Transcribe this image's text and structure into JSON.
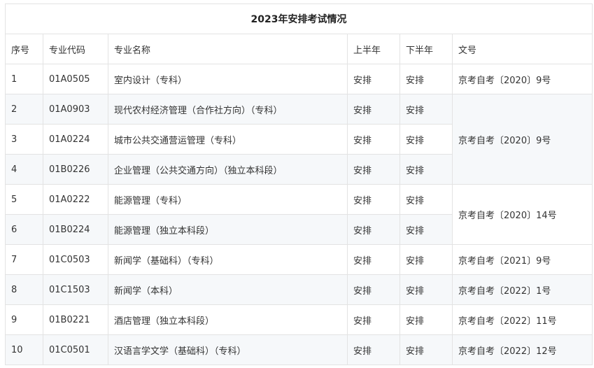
{
  "title": "2023年安排考试情况",
  "headers": {
    "seq": "序号",
    "code": "专业代码",
    "name": "专业名称",
    "h1": "上半年",
    "h2": "下半年",
    "doc": "文号"
  },
  "rows": [
    {
      "seq": "1",
      "code": "01A0505",
      "name": "室内设计（专科）",
      "h1": "安排",
      "h2": "安排"
    },
    {
      "seq": "2",
      "code": "01A0903",
      "name": "现代农村经济管理（合作社方向）（专科）",
      "h1": "安排",
      "h2": "安排"
    },
    {
      "seq": "3",
      "code": "01A0224",
      "name": "城市公共交通营运管理（专科）",
      "h1": "安排",
      "h2": "安排"
    },
    {
      "seq": "4",
      "code": "01B0226",
      "name": "企业管理（公共交通方向）（独立本科段）",
      "h1": "安排",
      "h2": "安排"
    },
    {
      "seq": "5",
      "code": "01A0222",
      "name": "能源管理（专科）",
      "h1": "安排",
      "h2": "安排"
    },
    {
      "seq": "6",
      "code": "01B0224",
      "name": "能源管理（独立本科段）",
      "h1": "安排",
      "h2": "安排"
    },
    {
      "seq": "7",
      "code": "01C0503",
      "name": "新闻学（基础科）（专科）",
      "h1": "安排",
      "h2": "安排"
    },
    {
      "seq": "8",
      "code": "01C1503",
      "name": "新闻学（本科）",
      "h1": "安排",
      "h2": "安排"
    },
    {
      "seq": "9",
      "code": "01B0221",
      "name": "酒店管理（独立本科段）",
      "h1": "安排",
      "h2": "安排"
    },
    {
      "seq": "10",
      "code": "01C0501",
      "name": "汉语言学文学（基础科）（专科）",
      "h1": "安排",
      "h2": "安排"
    }
  ],
  "docs": [
    "京考自考〔2020〕9号",
    "京考自考〔2020〕9号",
    "京考自考〔2020〕14号",
    "京考自考〔2021〕9号",
    "京考自考〔2022〕1号",
    "京考自考〔2022〕11号",
    "京考自考〔2022〕12号"
  ]
}
